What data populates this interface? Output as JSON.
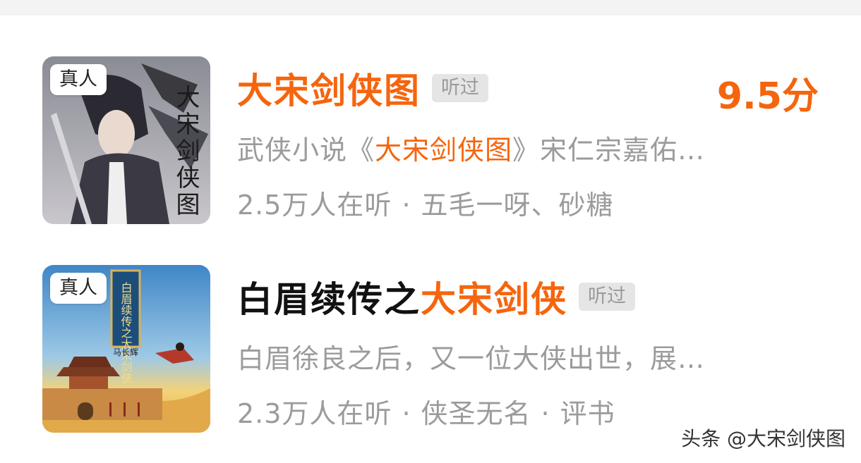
{
  "items": [
    {
      "cover_badge": "真人",
      "cover_title": "大宋剑侠图",
      "title_orange": "大宋剑侠图",
      "title_black": "",
      "tag": "听过",
      "score": "9.5分",
      "desc_before": "武侠小说《",
      "desc_highlight": "大宋剑侠图",
      "desc_after": "》宋仁宗嘉佑…",
      "listeners": "2.5万人在听",
      "separator": "·",
      "authors": "五毛一呀、砂糖"
    },
    {
      "cover_badge": "真人",
      "cover_title": "白眉续传之大宋剑侠",
      "cover_author": "马长辉",
      "title_black": "白眉续传之",
      "title_orange": "大宋剑侠",
      "tag": "听过",
      "desc": "白眉徐良之后，又一位大侠出世，展…",
      "listeners": "2.3万人在听",
      "separator": "·",
      "author": "侠圣无名",
      "category": "评书"
    }
  ],
  "watermark": "头条 @大宋剑侠图",
  "colors": {
    "accent": "#f5650e",
    "muted": "#9b9b9b",
    "tag_bg": "#e5e5e5"
  }
}
